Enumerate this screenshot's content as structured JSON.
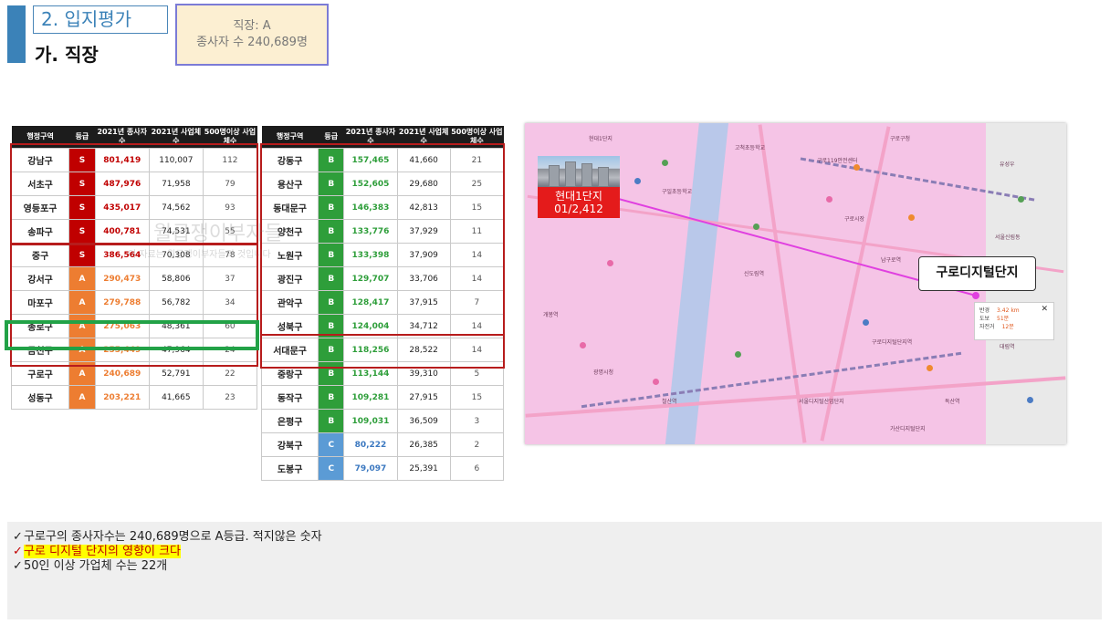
{
  "header": {
    "section_title": "2. 입지평가",
    "subtitle": "가. 직장",
    "info_line1": "직장: A",
    "info_line2": "종사자 수 240,689명"
  },
  "table_columns": [
    "행정구역",
    "등급",
    "2021년 종사자수",
    "2021년 사업체수",
    "500명이상 사업체수"
  ],
  "table_left": [
    {
      "district": "강남구",
      "grade": "S",
      "workers": "801,419",
      "businesses": "110,007",
      "large": "112"
    },
    {
      "district": "서초구",
      "grade": "S",
      "workers": "487,976",
      "businesses": "71,958",
      "large": "79"
    },
    {
      "district": "영등포구",
      "grade": "S",
      "workers": "435,017",
      "businesses": "74,562",
      "large": "93"
    },
    {
      "district": "송파구",
      "grade": "S",
      "workers": "400,781",
      "businesses": "74,531",
      "large": "55"
    },
    {
      "district": "중구",
      "grade": "S",
      "workers": "386,564",
      "businesses": "70,308",
      "large": "78"
    },
    {
      "district": "강서구",
      "grade": "A",
      "workers": "290,473",
      "businesses": "58,806",
      "large": "37"
    },
    {
      "district": "마포구",
      "grade": "A",
      "workers": "279,788",
      "businesses": "56,782",
      "large": "34"
    },
    {
      "district": "종로구",
      "grade": "A",
      "workers": "275,063",
      "businesses": "48,361",
      "large": "60"
    },
    {
      "district": "금천구",
      "grade": "A",
      "workers": "255,449",
      "businesses": "47,964",
      "large": "24"
    },
    {
      "district": "구로구",
      "grade": "A",
      "workers": "240,689",
      "businesses": "52,791",
      "large": "22"
    },
    {
      "district": "성동구",
      "grade": "A",
      "workers": "203,221",
      "businesses": "41,665",
      "large": "23"
    }
  ],
  "table_right": [
    {
      "district": "강동구",
      "grade": "B",
      "workers": "157,465",
      "businesses": "41,660",
      "large": "21"
    },
    {
      "district": "용산구",
      "grade": "B",
      "workers": "152,605",
      "businesses": "29,680",
      "large": "25"
    },
    {
      "district": "동대문구",
      "grade": "B",
      "workers": "146,383",
      "businesses": "42,813",
      "large": "15"
    },
    {
      "district": "양천구",
      "grade": "B",
      "workers": "133,776",
      "businesses": "37,929",
      "large": "11"
    },
    {
      "district": "노원구",
      "grade": "B",
      "workers": "133,398",
      "businesses": "37,909",
      "large": "14"
    },
    {
      "district": "광진구",
      "grade": "B",
      "workers": "129,707",
      "businesses": "33,706",
      "large": "14"
    },
    {
      "district": "관악구",
      "grade": "B",
      "workers": "128,417",
      "businesses": "37,915",
      "large": "7"
    },
    {
      "district": "성북구",
      "grade": "B",
      "workers": "124,004",
      "businesses": "34,712",
      "large": "14"
    },
    {
      "district": "서대문구",
      "grade": "B",
      "workers": "118,256",
      "businesses": "28,522",
      "large": "14"
    },
    {
      "district": "중랑구",
      "grade": "B",
      "workers": "113,144",
      "businesses": "39,310",
      "large": "5"
    },
    {
      "district": "동작구",
      "grade": "B",
      "workers": "109,281",
      "businesses": "27,915",
      "large": "15"
    },
    {
      "district": "은평구",
      "grade": "B",
      "workers": "109,031",
      "businesses": "36,509",
      "large": "3"
    },
    {
      "district": "강북구",
      "grade": "C",
      "workers": "80,222",
      "businesses": "26,385",
      "large": "2"
    },
    {
      "district": "도봉구",
      "grade": "C",
      "workers": "79,097",
      "businesses": "25,391",
      "large": "6"
    }
  ],
  "watermark": "월급쟁이부자들",
  "watermark_sub": "이 자료는 월급쟁이부자들의 것입니다",
  "map": {
    "origin_label": "현대1단지",
    "origin_sub": "01/2,412",
    "destination_label": "구로디지털단지",
    "route_popup": [
      {
        "label": "반경",
        "value": "3.42 km"
      },
      {
        "label": "도보",
        "value": "51분"
      },
      {
        "label": "자전거",
        "value": "12분"
      }
    ],
    "labels": [
      "구로구청",
      "구로119안전센터",
      "고척초등학교",
      "구일초등학교",
      "신도림역",
      "구로디지털단지역",
      "개봉역",
      "광명시청",
      "철산역",
      "서울디지털산업단지",
      "가산디지털단지",
      "남구로역",
      "독산역",
      "구로시장",
      "대림역",
      "서울신림동",
      "유성우",
      "현대1단지"
    ]
  },
  "notes": [
    {
      "text": "구로구의 종사자수는 240,689명으로 A등급. 적지않은 숫자",
      "highlight": false
    },
    {
      "text": "구로 디지털 단지의 영향이 크다",
      "highlight": true
    },
    {
      "text": "50인 이상 가업체 수는 22개",
      "highlight": false
    }
  ],
  "colors": {
    "S": "#c00000",
    "A": "#ed7d31",
    "B": "#2e9e3a",
    "C": "#5b9bd5",
    "accent": "#3b82b8",
    "highlight_box": "#22a247"
  }
}
